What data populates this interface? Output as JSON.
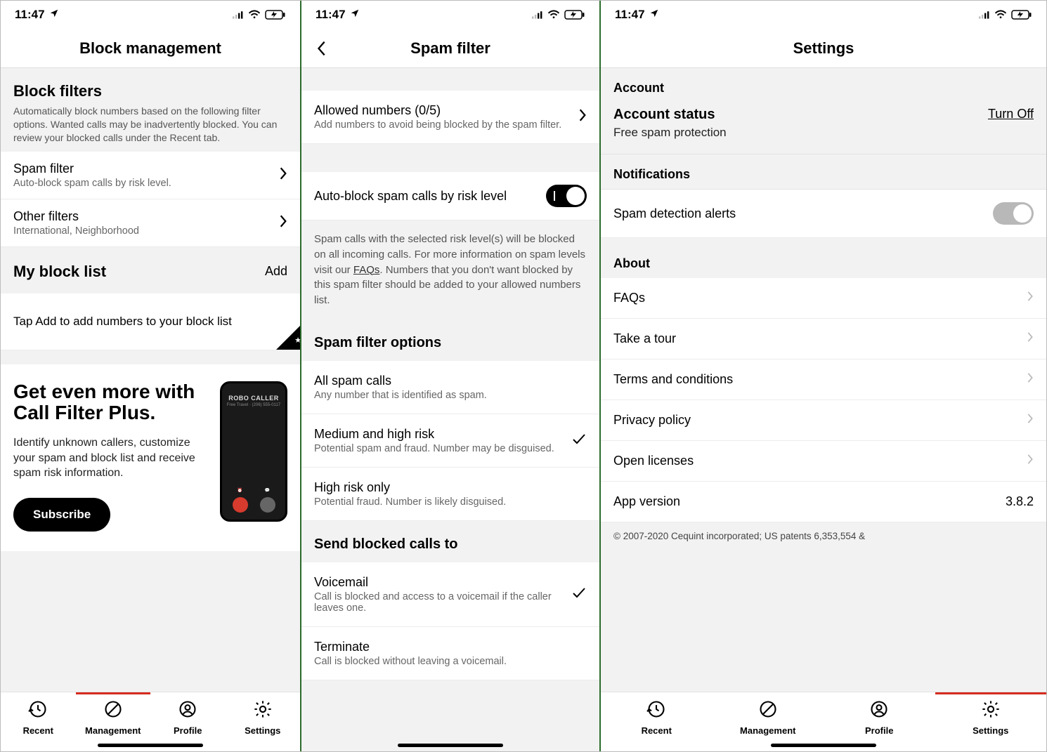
{
  "status": {
    "time": "11:47",
    "location_on": true
  },
  "tabs": {
    "recent": "Recent",
    "management": "Management",
    "profile": "Profile",
    "settings": "Settings"
  },
  "screen1": {
    "title": "Block management",
    "block_filters": {
      "heading": "Block filters",
      "desc": "Automatically block numbers based on the following filter options. Wanted calls may be inadvertently blocked. You can review your blocked calls under the Recent tab."
    },
    "spam_filter": {
      "title": "Spam filter",
      "sub": "Auto-block spam calls by risk level."
    },
    "other_filters": {
      "title": "Other filters",
      "sub": "International, Neighborhood"
    },
    "my_block_list": {
      "heading": "My block list",
      "add": "Add",
      "hint": "Tap Add to add numbers to your block list"
    },
    "promo": {
      "title": "Get even more with Call Filter Plus.",
      "desc": "Identify unknown callers, customize your spam and block list and receive spam risk information.",
      "cta": "Subscribe",
      "phone_label": "ROBO CALLER",
      "phone_sub": "Free Travel · (206) 555-0117"
    }
  },
  "screen2": {
    "title": "Spam filter",
    "allowed": {
      "title": "Allowed numbers (0/5)",
      "sub": "Add numbers to avoid being blocked by the spam filter."
    },
    "autoblock": {
      "label": "Auto-block spam calls by risk level",
      "on": true
    },
    "explain_a": "Spam calls with the selected risk level(s) will be blocked on all incoming calls. For more information on spam levels visit our ",
    "explain_link": "FAQs",
    "explain_b": ".  Numbers that you don't want blocked by this spam filter should be added to your allowed numbers list.",
    "options_heading": "Spam filter options",
    "options": [
      {
        "title": "All spam calls",
        "sub": "Any number that is identified as spam.",
        "selected": false
      },
      {
        "title": "Medium and high risk",
        "sub": "Potential spam and fraud. Number may be disguised.",
        "selected": true
      },
      {
        "title": "High risk only",
        "sub": "Potential fraud. Number is likely disguised.",
        "selected": false
      }
    ],
    "send_heading": "Send blocked calls to",
    "send": [
      {
        "title": "Voicemail",
        "sub": "Call is blocked and access to a voicemail if the caller leaves one.",
        "selected": true
      },
      {
        "title": "Terminate",
        "sub": "Call is blocked without leaving a voicemail.",
        "selected": false
      }
    ]
  },
  "screen3": {
    "title": "Settings",
    "account_label": "Account",
    "account_status": {
      "title": "Account status",
      "sub": "Free spam protection",
      "action": "Turn Off"
    },
    "notifications_label": "Notifications",
    "spam_alerts": {
      "label": "Spam detection alerts",
      "on": false
    },
    "about_label": "About",
    "about": [
      {
        "label": "FAQs"
      },
      {
        "label": "Take a tour"
      },
      {
        "label": "Terms and conditions"
      },
      {
        "label": "Privacy policy"
      },
      {
        "label": "Open licenses"
      }
    ],
    "version_label": "App version",
    "version_value": "3.8.2",
    "copyright": "© 2007-2020 Cequint incorporated; US patents 6,353,554 &"
  }
}
